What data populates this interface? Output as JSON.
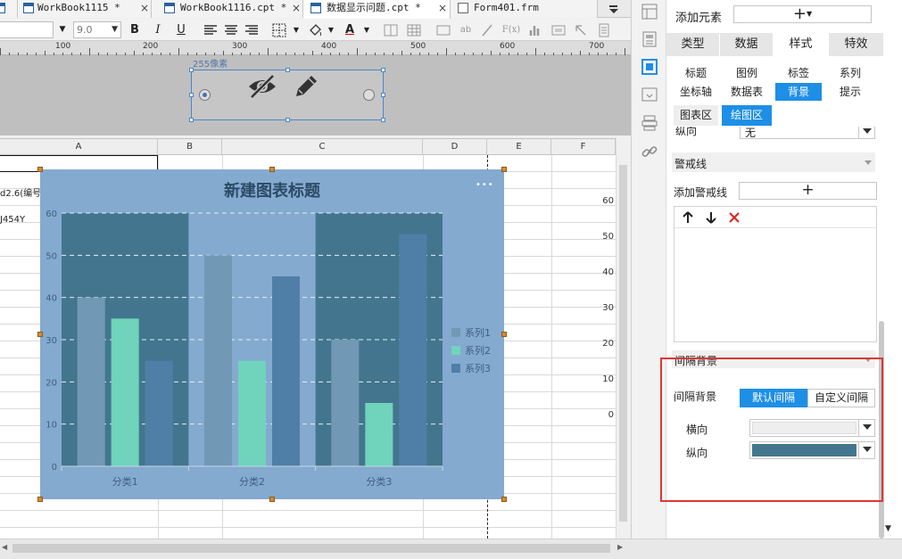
{
  "tabs": [
    {
      "label": "WorkBook1115 *"
    },
    {
      "label": "WorkBook1116.cpt *"
    },
    {
      "label": "数据显示问题.cpt *"
    },
    {
      "label": "Form401.frm"
    }
  ],
  "toolbar": {
    "font_size": "9.0",
    "bold": "B",
    "italic": "I",
    "underline": "U",
    "font_color": "A",
    "fx": "F(x)",
    "ab": "ab"
  },
  "ruler": {
    "ticks": [
      "100",
      "200",
      "300",
      "400",
      "500",
      "600",
      "700"
    ]
  },
  "form_widget": {
    "size_label": "255像素"
  },
  "sheet": {
    "columns": [
      "A",
      "B",
      "C",
      "D",
      "E",
      "F"
    ],
    "cell_a1": "d2.6(编号",
    "cell_a2": "J454Y",
    "right_axis": [
      "60",
      "50",
      "40",
      "30",
      "20",
      "10",
      "0"
    ]
  },
  "chart_data": {
    "type": "bar",
    "title": "新建图表标题",
    "more_label": "•••",
    "categories": [
      "分类1",
      "分类2",
      "分类3"
    ],
    "y_ticks": [
      "0",
      "10",
      "20",
      "30",
      "40",
      "50",
      "60"
    ],
    "ylim": [
      0,
      60
    ],
    "series": [
      {
        "name": "系列1",
        "values": [
          40,
          50,
          30
        ],
        "color": "#7199b5"
      },
      {
        "name": "系列2",
        "values": [
          35,
          25,
          15
        ],
        "color": "#6fd4bb"
      },
      {
        "name": "系列3",
        "values": [
          25,
          45,
          55
        ],
        "color": "#4f7fa7"
      }
    ],
    "band_color": "#43768e",
    "grid": true,
    "legend_position": "right"
  },
  "panel": {
    "add_element_label": "添加元素",
    "add_symbol": "+",
    "main_tabs": [
      "类型",
      "数据",
      "样式",
      "特效"
    ],
    "active_main_tab": "样式",
    "sub_tabs_row1": [
      "标题",
      "图例",
      "标签",
      "系列"
    ],
    "sub_tabs_row2": [
      "坐标轴",
      "数据表",
      "背景",
      "提示"
    ],
    "area_tabs": [
      "图表区",
      "绘图区"
    ],
    "partial_label": "纵向",
    "partial_value": "无",
    "warning_line_section": "警戒线",
    "add_warning_line": "添加警戒线",
    "interval_section": "间隔背景",
    "interval_bg_label": "间隔背景",
    "interval_options": [
      "默认间隔",
      "自定义间隔"
    ],
    "horizontal_label": "横向",
    "vertical_label": "纵向",
    "horizontal_color": "#eeeeee",
    "vertical_color": "#43768e"
  }
}
